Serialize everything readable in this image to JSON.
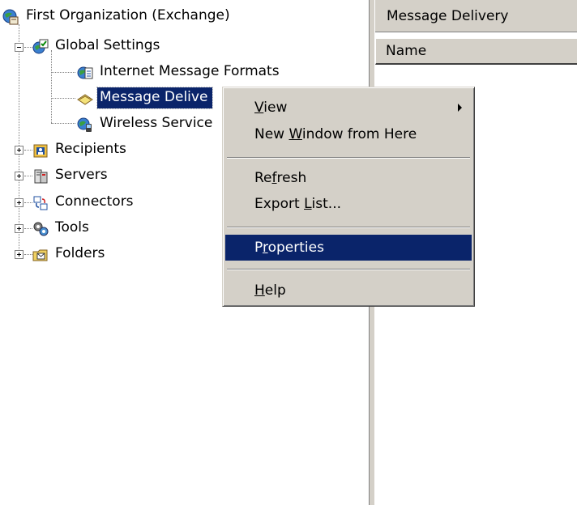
{
  "tree": {
    "root": "First Organization (Exchange)",
    "global_settings": "Global Settings",
    "internet_message_formats": "Internet Message Formats",
    "message_delivery": "Message Delive",
    "wireless_services": "Wireless Service",
    "recipients": "Recipients",
    "servers": "Servers",
    "connectors": "Connectors",
    "tools": "Tools",
    "folders": "Folders"
  },
  "right_pane": {
    "title": "Message Delivery",
    "column_name": "Name"
  },
  "context_menu": {
    "view": {
      "pre": "",
      "acc": "V",
      "post": "iew"
    },
    "new_window": {
      "pre": "New ",
      "acc": "W",
      "post": "indow from Here"
    },
    "refresh": {
      "pre": "Re",
      "acc": "f",
      "post": "resh"
    },
    "export_list": {
      "pre": "Export ",
      "acc": "L",
      "post": "ist..."
    },
    "properties": {
      "pre": "P",
      "acc": "r",
      "post": "operties"
    },
    "help": {
      "pre": "",
      "acc": "H",
      "post": "elp"
    }
  },
  "colors": {
    "selection": "#0a246a",
    "chrome": "#d4d0c8"
  },
  "icons": [
    "org-globe-icon",
    "global-settings-icon",
    "internet-formats-icon",
    "message-delivery-icon",
    "wireless-services-icon",
    "recipients-icon",
    "servers-icon",
    "connectors-icon",
    "tools-icon",
    "folders-icon",
    "submenu-arrow-icon"
  ]
}
